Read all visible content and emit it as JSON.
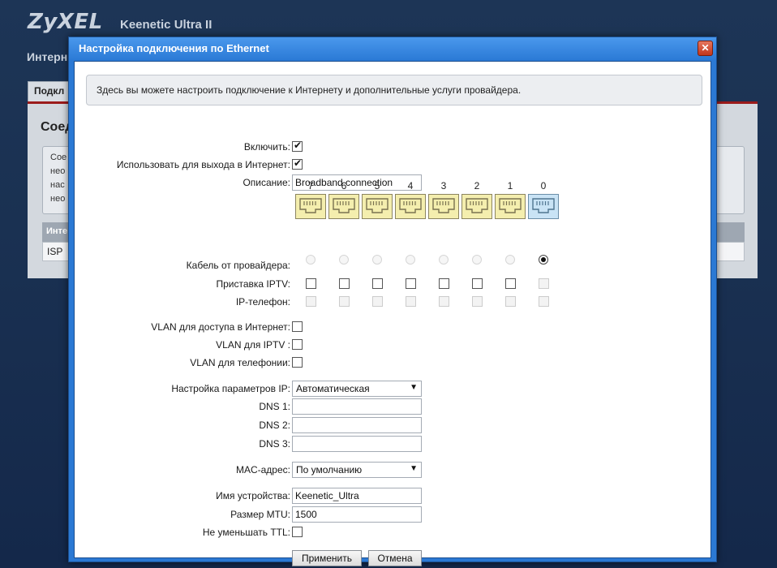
{
  "background": {
    "logo": "ZyXEL",
    "model": "Keenetic Ultra II",
    "section_title": "Интерн",
    "tab": "Подкл",
    "panel_title": "Соед",
    "info_lines": [
      "Сое",
      "нео",
      "нас",
      "нео"
    ],
    "table_header": "Инте",
    "table_row": "ISP"
  },
  "dialog": {
    "title": "Настройка подключения по Ethernet",
    "close_label": "✕",
    "info_text": "Здесь вы можете настроить подключение к Интернету и дополнительные услуги провайдера.",
    "enable_label": "Включить:",
    "enable_checked": true,
    "internet_label": "Использовать для выхода в Интернет:",
    "internet_checked": true,
    "description_label": "Описание:",
    "description_value": "Broadband connection",
    "ports": [
      "7",
      "6",
      "5",
      "4",
      "3",
      "2",
      "1",
      "0"
    ],
    "selected_port": "0",
    "provider_cable_label": "Кабель от провайдера:",
    "iptv_label": "Приставка IPTV:",
    "ip_phone_label": "IP-телефон:",
    "vlan_internet_label": "VLAN для доступа в Интернет:",
    "vlan_iptv_label": "VLAN для IPTV :",
    "vlan_phone_label": "VLAN для телефонии:",
    "ip_settings_label": "Настройка параметров IP:",
    "ip_settings_value": "Автоматическая",
    "dns1_label": "DNS 1:",
    "dns2_label": "DNS 2:",
    "dns3_label": "DNS 3:",
    "dns1_value": "",
    "dns2_value": "",
    "dns3_value": "",
    "mac_label": "MAC-адрес:",
    "mac_value": "По умолчанию",
    "device_name_label": "Имя устройства:",
    "device_name_value": "Keenetic_Ultra",
    "mtu_label": "Размер MTU:",
    "mtu_value": "1500",
    "ttl_label": "Не уменьшать TTL:",
    "ttl_checked": false,
    "apply_label": "Применить",
    "cancel_label": "Отмена"
  },
  "colors": {
    "title_bar": "#2b7ad6",
    "port_yellow": "#f4eeae",
    "port_blue": "#c9e3f5",
    "accent_red": "#9b1b1b"
  }
}
